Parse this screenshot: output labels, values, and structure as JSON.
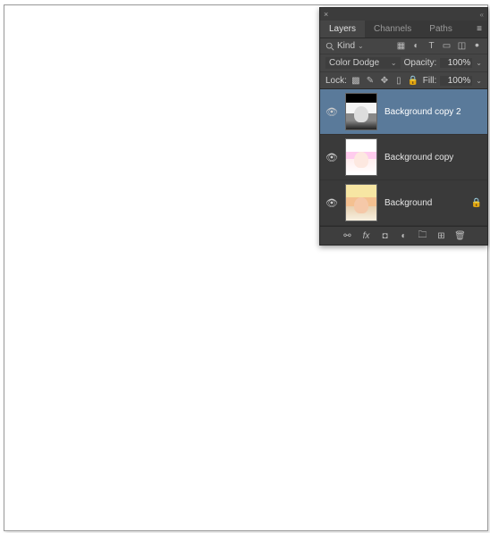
{
  "tabs": {
    "layers": "Layers",
    "channels": "Channels",
    "paths": "Paths"
  },
  "filter": {
    "kind": "Kind"
  },
  "blend": {
    "mode": "Color Dodge",
    "opacity_label": "Opacity:",
    "opacity_value": "100%",
    "fill_label": "Fill:",
    "fill_value": "100%",
    "lock_label": "Lock:"
  },
  "layers": [
    {
      "name": "Background copy 2",
      "selected": true,
      "locked": false,
      "thumb": "bw"
    },
    {
      "name": "Background copy",
      "selected": false,
      "locked": false,
      "thumb": "light"
    },
    {
      "name": "Background",
      "selected": false,
      "locked": true,
      "thumb": "color"
    }
  ]
}
